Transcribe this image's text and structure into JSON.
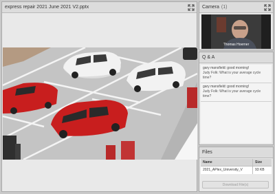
{
  "share": {
    "title": "express repair 2021 June 2021 V2.pptx"
  },
  "camera": {
    "title": "Camera",
    "count": "(1)",
    "participant": "Thomas Hoerner"
  },
  "qa": {
    "title": "Q & A",
    "items": [
      {
        "question": "gary mansfield: good morning!",
        "answer": "Judy Folk: What is your average cycle time?"
      },
      {
        "question": "gary mansfield: good morning!",
        "answer": "Judy Folk: What is your average cycle time?"
      }
    ]
  },
  "files": {
    "title": "Files",
    "columns": {
      "name": "Name",
      "size": "Size"
    },
    "rows": [
      {
        "name": "2021_APlex_University_V",
        "size": "93 KB"
      }
    ],
    "download_label": "Download File(s)"
  },
  "colors": {
    "pane_bg": "#e9e9e9",
    "header_bg": "#dcdcdc",
    "car_red": "#c81e1e",
    "car_white": "#f2f2f2"
  },
  "icons": {
    "expand": "expand-arrows-icon"
  }
}
